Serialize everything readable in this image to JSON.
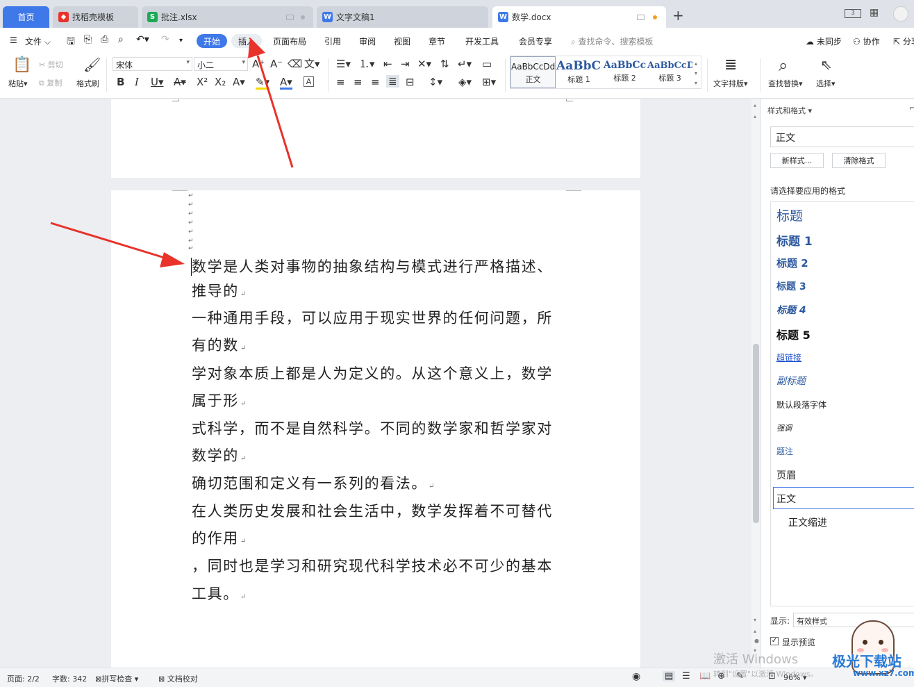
{
  "tabs": [
    {
      "label": "首页",
      "icon": "home"
    },
    {
      "label": "找稻壳模板",
      "icon": "docer-icon"
    },
    {
      "label": "批注.xlsx",
      "icon": "spreadsheet-icon"
    },
    {
      "label": "文字文稿1",
      "icon": "writer-icon"
    },
    {
      "label": "数学.docx",
      "icon": "writer-icon"
    }
  ],
  "menu": {
    "file": "文件",
    "items": [
      "开始",
      "插入",
      "页面布局",
      "引用",
      "审阅",
      "视图",
      "章节",
      "开发工具",
      "会员专享"
    ],
    "search_placeholder": "查找命令、搜索模板",
    "sync": "未同步",
    "collab": "协作",
    "share": "分享"
  },
  "ribbon": {
    "paste": "粘贴",
    "cut": "剪切",
    "copy": "复制",
    "format_painter": "格式刷",
    "font_name": "宋体",
    "font_size": "小二",
    "styles": [
      {
        "preview": "AaBbCcDd",
        "name": "正文"
      },
      {
        "preview": "AaBbCc",
        "name": "标题 1"
      },
      {
        "preview": "AaBbCc",
        "name": "标题 2"
      },
      {
        "preview": "AaBbCcD",
        "name": "标题 3"
      }
    ],
    "text_layout": "文字排版",
    "find_replace": "查找替换",
    "select": "选择"
  },
  "document": {
    "lines": [
      "数学是人类对事物的抽象结构与模式进行严格描述、",
      "推导的",
      "一种通用手段，可以应用于现实世界的任何问题，所",
      "有的数",
      "学对象本质上都是人为定义的。从这个意义上，数学",
      "属于形",
      "式科学，而不是自然科学。不同的数学家和哲学家对",
      "数学的",
      "确切范围和定义有一系列的看法。",
      "在人类历史发展和社会生活中，数学发挥着不可替代",
      "的作用",
      "，同时也是学习和研究现代科学技术必不可少的基本",
      "工具。"
    ],
    "para_mark": "↵"
  },
  "panel": {
    "title": "样式和格式",
    "current_style": "正文",
    "new_style": "新样式...",
    "clear_format": "清除格式",
    "prompt": "请选择要应用的格式",
    "styles": [
      "标题",
      "标题 1",
      "标题 2",
      "标题 3",
      "标题 4",
      "标题 5",
      "超链接",
      "副标题",
      "默认段落字体",
      "强调",
      "题注",
      "页眉",
      "正文",
      "正文缩进"
    ],
    "show_label": "显示:",
    "show_value": "有效样式",
    "preview_label": "显示预览",
    "preview_checked": true
  },
  "status": {
    "page": "页面: 2/2",
    "words": "字数: 342",
    "spellcheck": "拼写检查",
    "proofread": "文档校对",
    "zoom": "96%"
  },
  "watermark": {
    "activate_title": "激活 Windows",
    "activate_sub": "转到\"设置\"以激活 Windows。",
    "brand": "极光下载站",
    "brand_url": "www.xz7.com"
  },
  "colors": {
    "accent": "#3f78e8",
    "heading_blue": "#2d5aa0",
    "arrow_red": "#e8322a"
  }
}
